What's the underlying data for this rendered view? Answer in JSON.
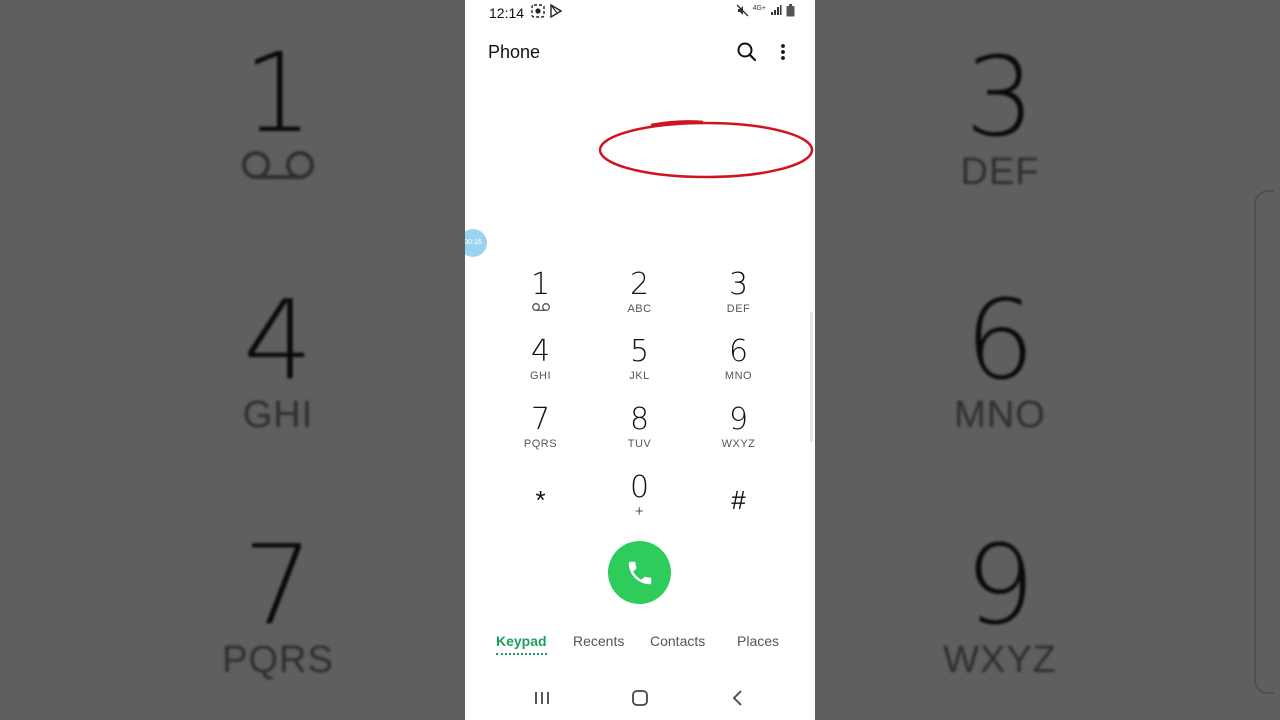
{
  "background": {
    "left": [
      {
        "digit": "1",
        "letters": "voicemail"
      },
      {
        "digit": "4",
        "letters": "GHI"
      },
      {
        "digit": "7",
        "letters": "PQRS"
      }
    ],
    "right": [
      {
        "digit": "3",
        "letters": "DEF"
      },
      {
        "digit": "6",
        "letters": "MNO"
      },
      {
        "digit": "9",
        "letters": "WXYZ"
      }
    ]
  },
  "status_bar": {
    "time": "12:14",
    "network": "4G+"
  },
  "app_bar": {
    "title": "Phone"
  },
  "bubble": {
    "label": "00:16"
  },
  "keypad": [
    {
      "digit": "1",
      "letters": ""
    },
    {
      "digit": "2",
      "letters": "ABC"
    },
    {
      "digit": "3",
      "letters": "DEF"
    },
    {
      "digit": "4",
      "letters": "GHI"
    },
    {
      "digit": "5",
      "letters": "JKL"
    },
    {
      "digit": "6",
      "letters": "MNO"
    },
    {
      "digit": "7",
      "letters": "PQRS"
    },
    {
      "digit": "8",
      "letters": "TUV"
    },
    {
      "digit": "9",
      "letters": "WXYZ"
    },
    {
      "digit": "*",
      "letters": ""
    },
    {
      "digit": "0",
      "letters": "+"
    },
    {
      "digit": "#",
      "letters": ""
    }
  ],
  "tabs": [
    {
      "label": "Keypad",
      "active": true
    },
    {
      "label": "Recents",
      "active": false
    },
    {
      "label": "Contacts",
      "active": false
    },
    {
      "label": "Places",
      "active": false
    }
  ],
  "colors": {
    "accent": "#1e9d5d",
    "call_button": "#2ecc5a",
    "annotation": "#d0141f"
  }
}
